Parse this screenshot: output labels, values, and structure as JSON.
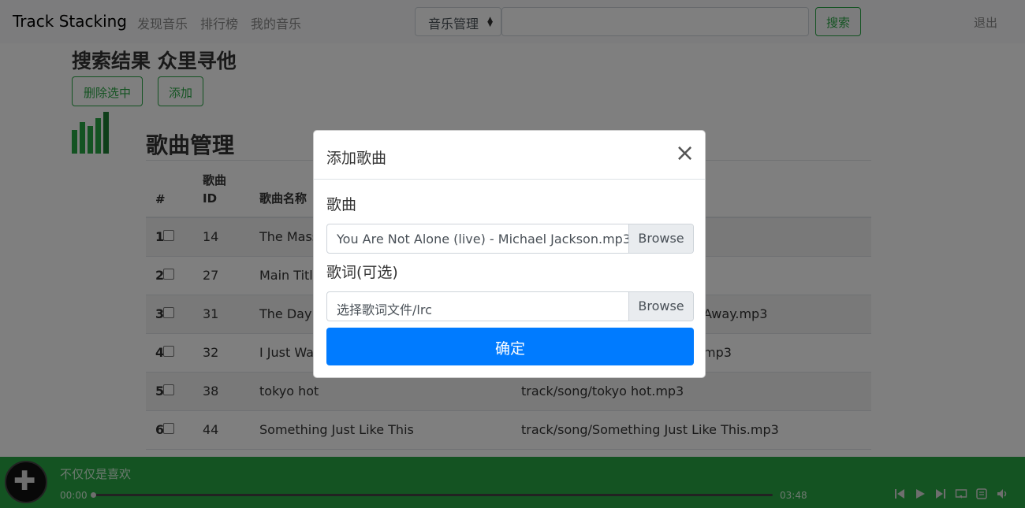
{
  "navbar": {
    "brand": "Track Stacking",
    "links": [
      "发现音乐",
      "排行榜",
      "我的音乐"
    ],
    "search_select": "音乐管理",
    "search_button": "搜索",
    "logout": "退出"
  },
  "main": {
    "results_title": "搜索结果 众里寻他",
    "delete_selected": "删除选中",
    "add": "添加",
    "section_title": "歌曲管理",
    "table": {
      "headers": [
        "#",
        "歌曲\nID",
        "歌曲名称"
      ],
      "rows": [
        {
          "index": "1",
          "id": "14",
          "name": "The Mass",
          "path": ""
        },
        {
          "index": "2",
          "id": "27",
          "name": "Main Title",
          "path": ""
        },
        {
          "index": "3",
          "id": "31",
          "name": "The Day Y",
          "path": "Away.mp3"
        },
        {
          "index": "4",
          "id": "32",
          "name": "I Just Wa",
          "path": "mp3"
        },
        {
          "index": "5",
          "id": "38",
          "name": "tokyo hot",
          "path": "track/song/tokyo hot.mp3"
        },
        {
          "index": "6",
          "id": "44",
          "name": "Something Just Like This",
          "path": "track/song/Something Just Like This.mp3"
        }
      ]
    }
  },
  "modal": {
    "title": "添加歌曲",
    "close": "×",
    "song_label": "歌曲",
    "song_file": "You Are Not Alone (live) - Michael Jackson.mp3",
    "browse": "Browse",
    "lyrics_label": "歌词(可选)",
    "lyrics_placeholder": "选择歌词文件/lrc",
    "confirm": "确定"
  },
  "player": {
    "track_title": "不仅仅是喜欢",
    "current_time": "00:00",
    "duration": "03:48",
    "progress": 0
  },
  "colors": {
    "accent": "#28a745",
    "primary": "#007bff"
  }
}
